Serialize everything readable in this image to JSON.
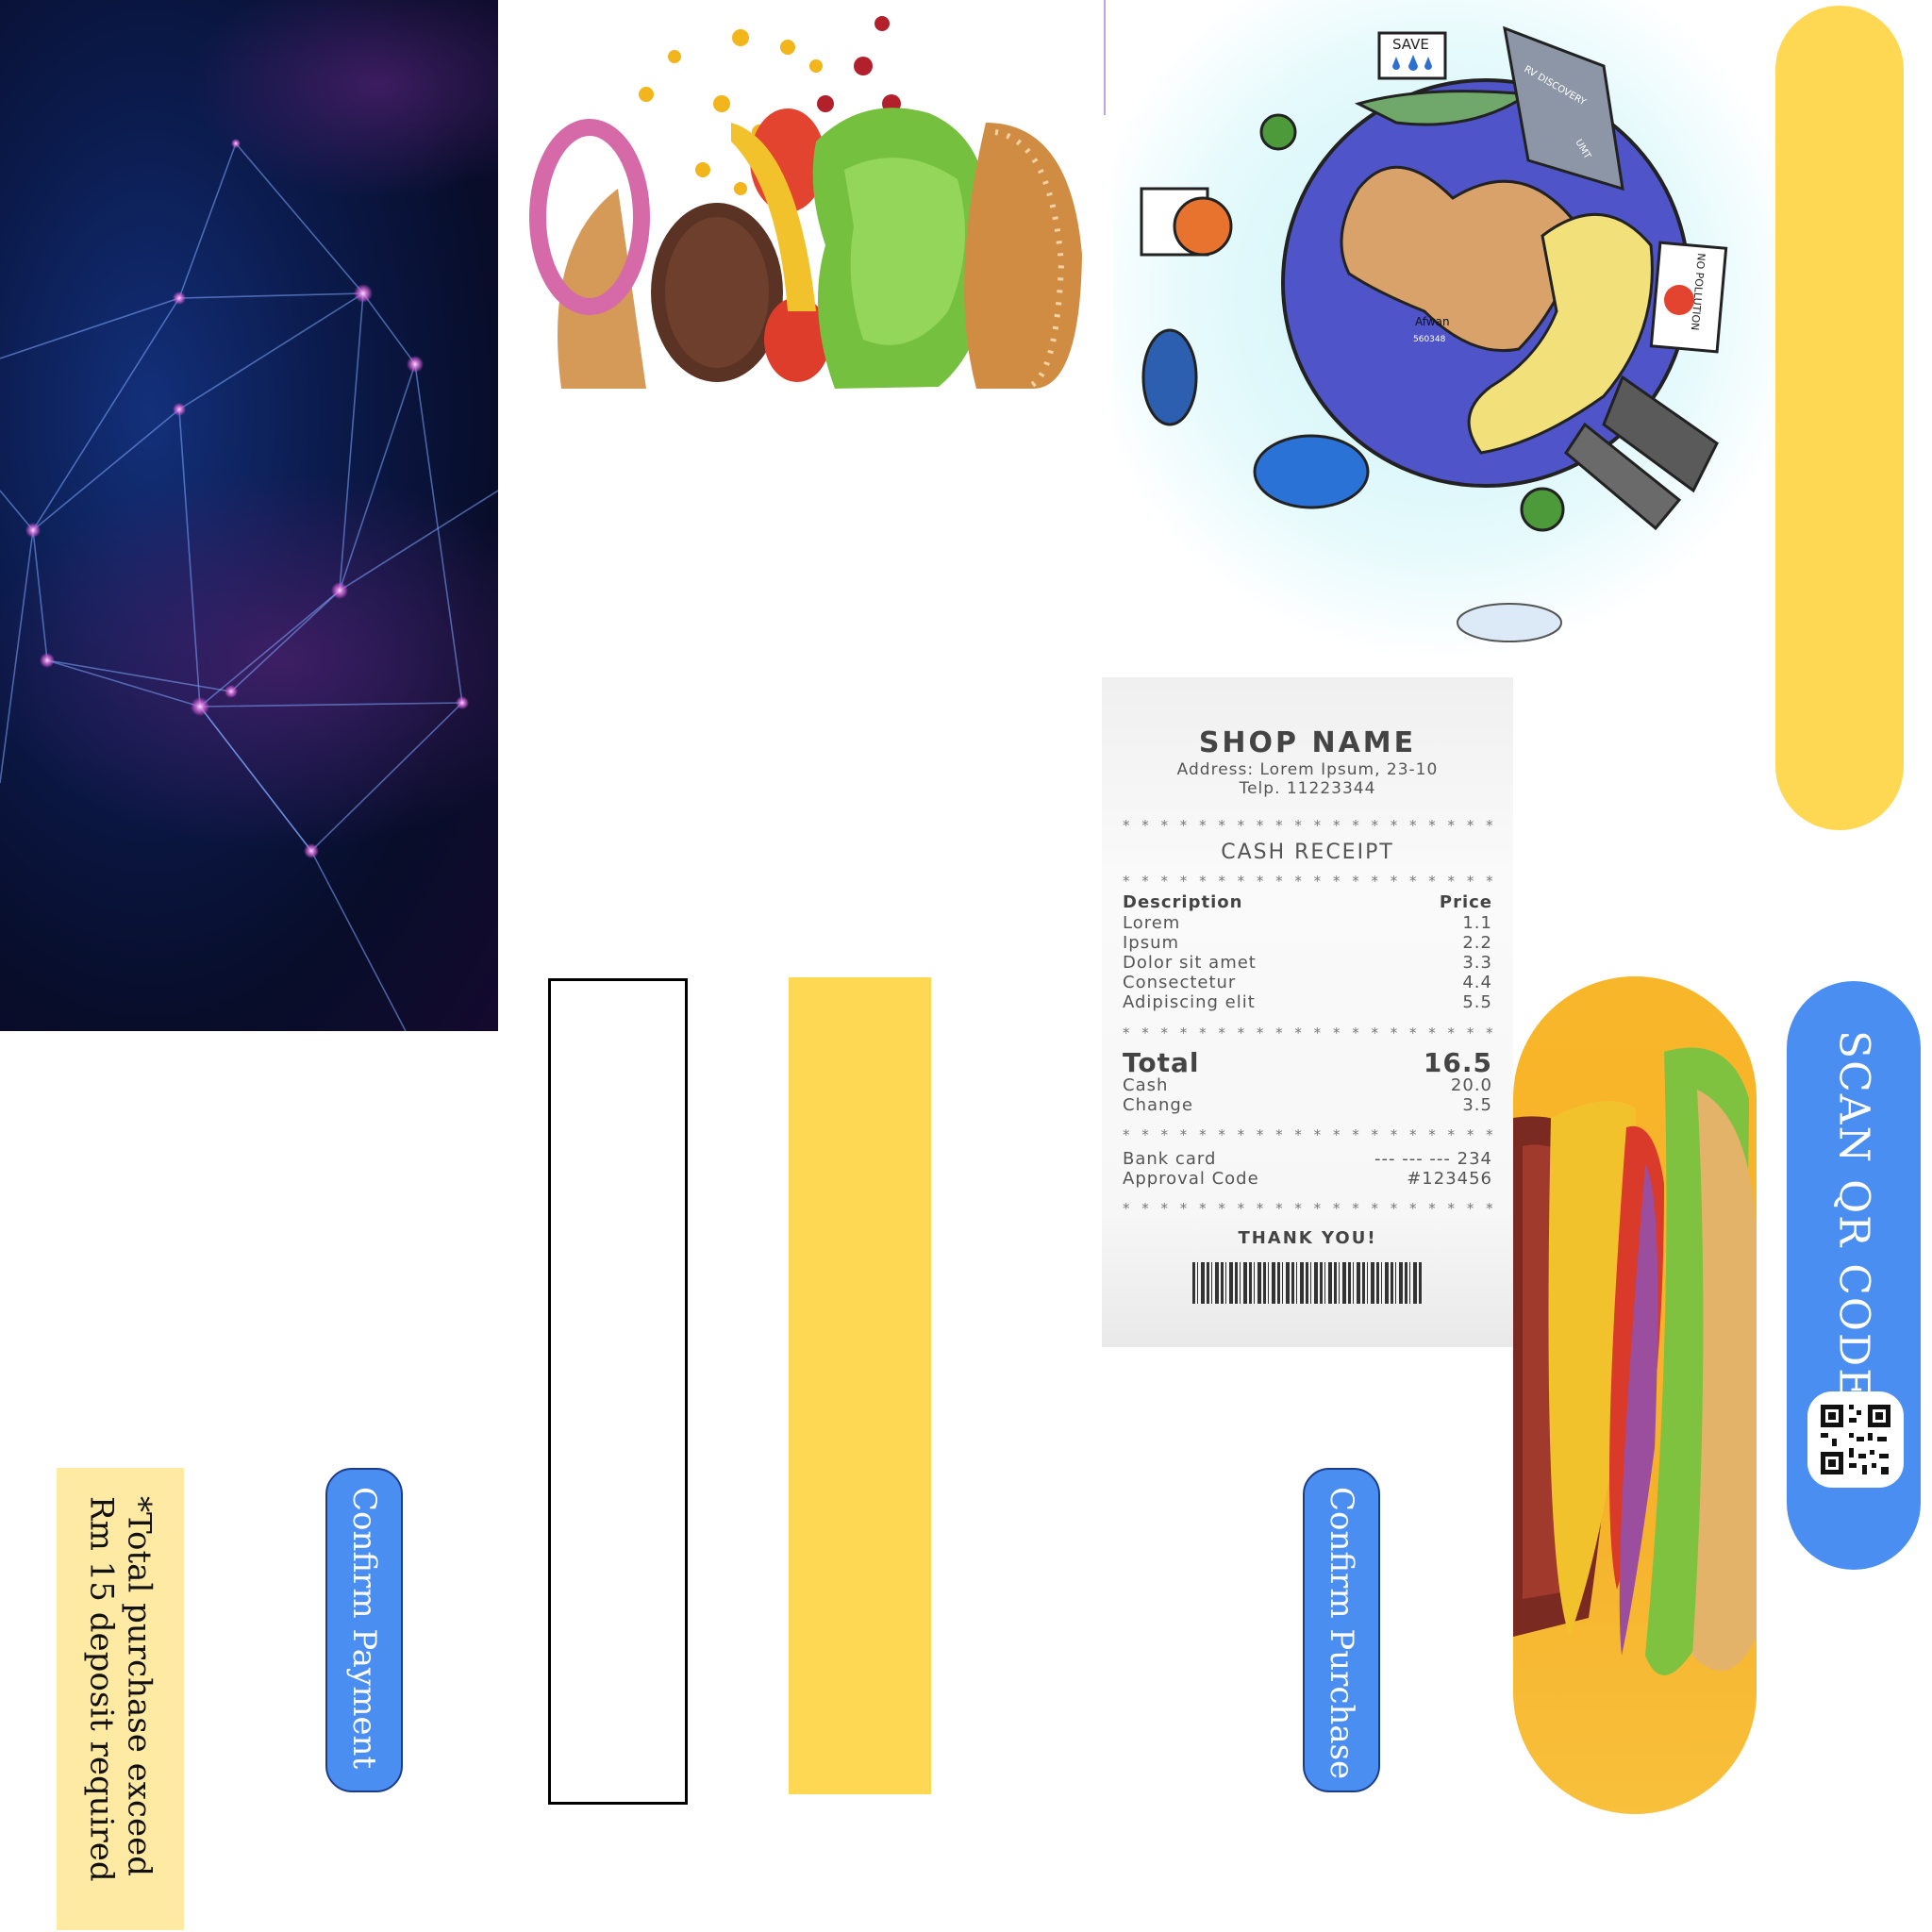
{
  "colors": {
    "accent_blue": "#4b8ef2",
    "accent_yellow": "#fed853",
    "note_yellow": "#ffeaa4"
  },
  "receipt": {
    "shop_name": "SHOP NAME",
    "address": "Address: Lorem Ipsum, 23-10",
    "phone": "Telp. 11223344",
    "title": "CASH RECEIPT",
    "col_description": "Description",
    "col_price": "Price",
    "items": [
      {
        "name": "Lorem",
        "price": "1.1"
      },
      {
        "name": "Ipsum",
        "price": "2.2"
      },
      {
        "name": "Dolor sit amet",
        "price": "3.3"
      },
      {
        "name": "Consectetur",
        "price": "4.4"
      },
      {
        "name": "Adipiscing elit",
        "price": "5.5"
      }
    ],
    "total_label": "Total",
    "total_value": "16.5",
    "cash_label": "Cash",
    "cash_value": "20.0",
    "change_label": "Change",
    "change_value": "3.5",
    "bank_label": "Bank card",
    "bank_value": "--- --- --- 234",
    "approval_label": "Approval Code",
    "approval_value": "#123456",
    "thanks": "THANK YOU!"
  },
  "earth_art": {
    "sign_save": "SAVE",
    "sign_no_pollution": "NO POLLUTION",
    "ship_name": "RV DISCOVERY",
    "ship_tag": "UMT",
    "map_label": "Afwan",
    "map_code": "560348"
  },
  "scan_qr": {
    "label": "SCAN QR CODE"
  },
  "buttons": {
    "confirm_payment": "Confirm Payment",
    "confirm_purchase": "Confirm Purchase"
  },
  "deposit_note": {
    "line1": "*Total purchase exceed",
    "line2": "Rm 15 deposit required"
  }
}
